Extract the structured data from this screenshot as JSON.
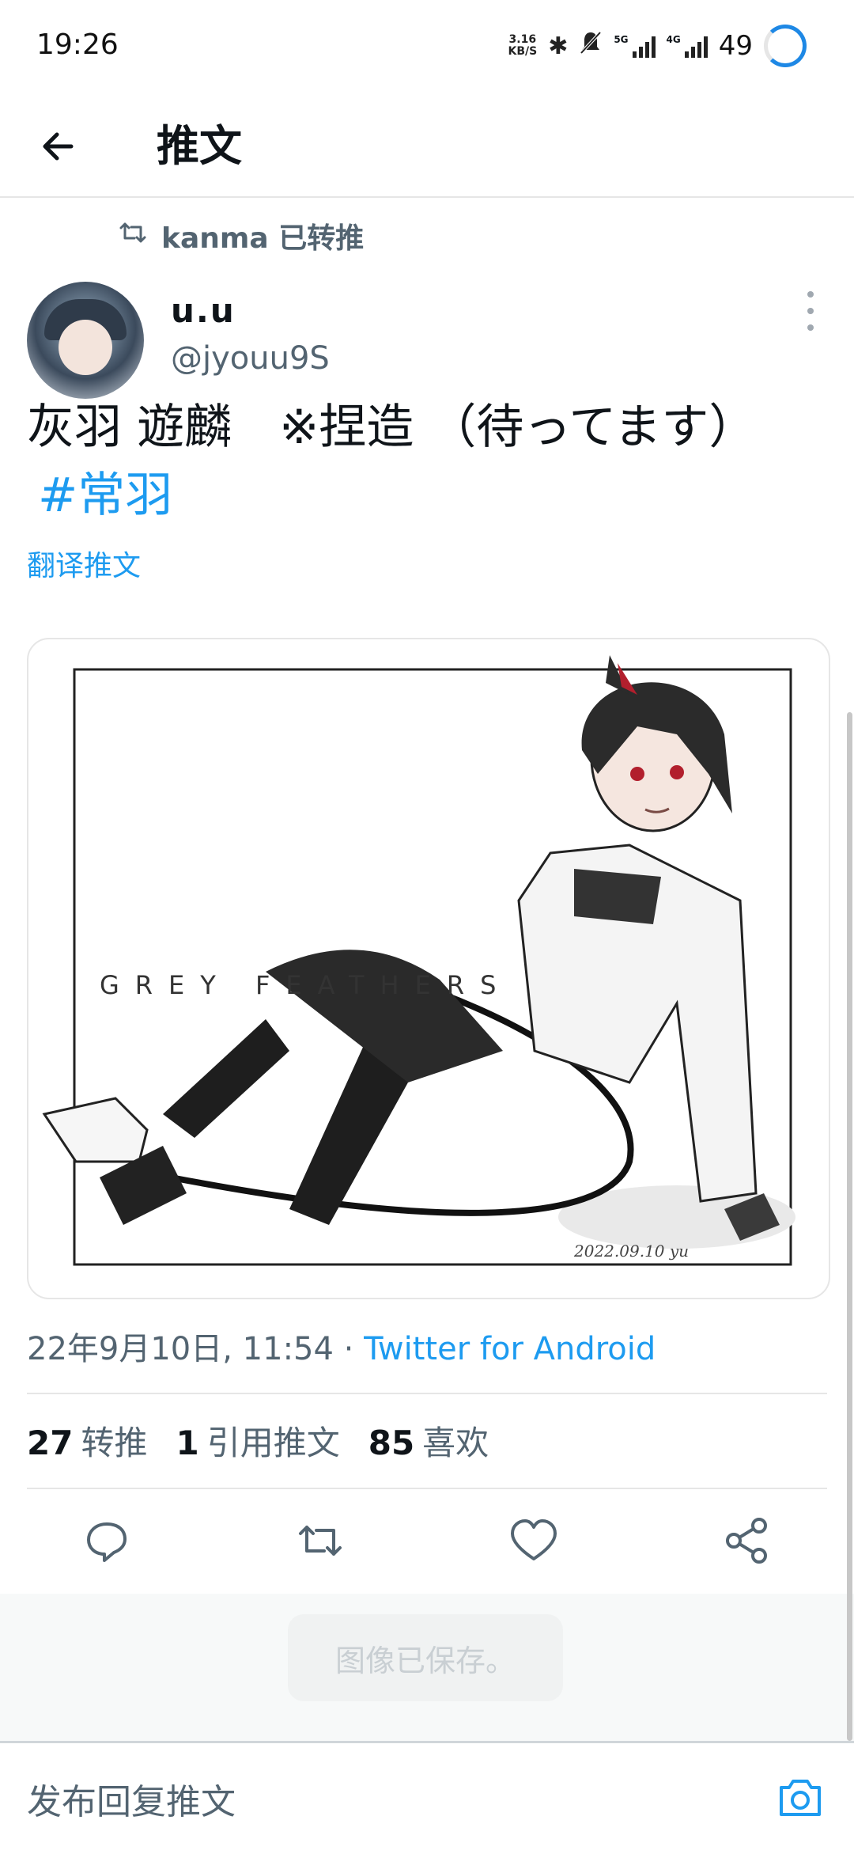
{
  "status_bar": {
    "time": "19:26",
    "net_speed_value": "3.16",
    "net_speed_unit": "KB/S",
    "net1": "5G",
    "net2": "4G",
    "battery": "49"
  },
  "header": {
    "title": "推文"
  },
  "retweet": {
    "label": "kanma 已转推"
  },
  "author": {
    "display_name": "u.u",
    "handle": "@jyouu9S"
  },
  "tweet": {
    "text": "灰羽 遊麟　※捏造 （待ってます）",
    "hashtag": "#常羽",
    "translate": "翻译推文"
  },
  "media": {
    "title_text": "GREY FEATHERS",
    "signature": "2022.09.10 yu"
  },
  "meta": {
    "timestamp": "22年9月10日, 11:54",
    "separator": " · ",
    "source": "Twitter for Android"
  },
  "stats": {
    "retweets_count": "27",
    "retweets_label": "转推",
    "quotes_count": "1",
    "quotes_label": "引用推文",
    "likes_count": "85",
    "likes_label": "喜欢"
  },
  "toast": {
    "text": "图像已保存。"
  },
  "reply": {
    "placeholder": "发布回复推文"
  },
  "colors": {
    "accent": "#1d9bf0",
    "secondary": "#536471"
  },
  "icons": [
    "back-arrow-icon",
    "retweet-icon",
    "more-vertical-icon",
    "reply-icon",
    "retweet-action-icon",
    "like-icon",
    "share-icon",
    "camera-icon"
  ]
}
